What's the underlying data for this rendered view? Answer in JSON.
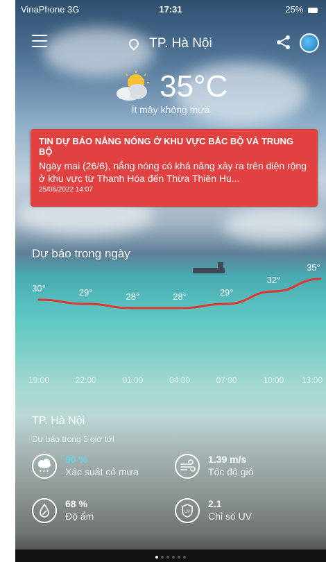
{
  "status_bar": {
    "carrier": "VinaPhone  3G",
    "time": "17:31",
    "battery": "25%"
  },
  "header": {
    "location": "TP. Hà Nội"
  },
  "current": {
    "temperature": "35°C",
    "description": "Ít mây không mưa",
    "icon": "partly-cloudy-sun-icon"
  },
  "alert": {
    "title": "TIN DỰ BÁO NẮNG NÓNG Ở KHU VỰC BẮC BỘ VÀ TRUNG BỘ",
    "body": "Ngày mai (26/6), nắng nóng có khả năng xảy ra trên diện rộng ở khu vực từ Thanh Hóa đến Thừa Thiên Hu...",
    "timestamp": "25/06/2022 14:07",
    "color": "#e24141"
  },
  "forecast": {
    "title": "Dự báo trong ngày"
  },
  "chart_data": {
    "type": "line",
    "x": [
      "19:00",
      "22:00",
      "01:00",
      "04:00",
      "07:00",
      "10:00",
      "13:00"
    ],
    "values": [
      30,
      29,
      28,
      28,
      29,
      32,
      35
    ],
    "labels": [
      "30°",
      "29°",
      "28°",
      "28°",
      "29°",
      "32°",
      "35°"
    ],
    "line_color": "#e3342f"
  },
  "details": {
    "location": "TP. Hà Nội",
    "subtitle": "Dự báo trong 3 giờ tới",
    "rain": {
      "value": "90 %",
      "label": "Xác suất có mưa",
      "icon": "rain-cloud-icon"
    },
    "wind": {
      "value": "1.39 m/s",
      "label": "Tốc độ gió",
      "icon": "wind-icon"
    },
    "humidity": {
      "value": "68 %",
      "label": "Độ ẩm",
      "icon": "humidity-drop-icon"
    },
    "uv": {
      "value": "2.1",
      "label": "Chỉ số UV",
      "icon": "uv-shield-icon"
    }
  },
  "pager": {
    "count": 6,
    "active": 0
  }
}
